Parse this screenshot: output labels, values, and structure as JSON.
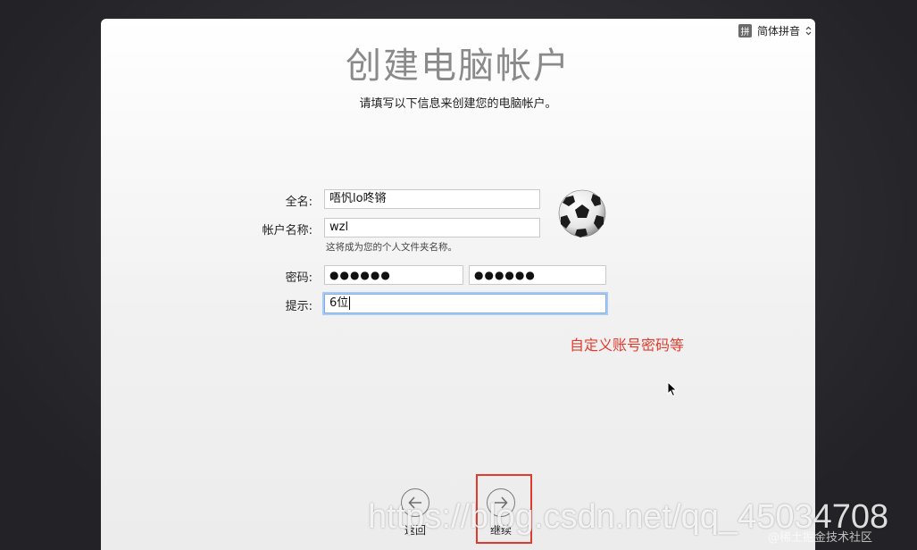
{
  "ime": {
    "badge": "拼",
    "label": "简体拼音"
  },
  "title": "创建电脑帐户",
  "subtitle": "请填写以下信息来创建您的电脑帐户。",
  "form": {
    "fullname_label": "全名:",
    "fullname_value": "唔忛lo咚锵",
    "account_label": "帐户名称:",
    "account_value": "wzl",
    "account_hint": "这将成为您的个人文件夹名称。",
    "password_label": "密码:",
    "password_value": "●●●●●●",
    "verify_value": "●●●●●●",
    "hint_label": "提示:",
    "hint_value": "6位"
  },
  "annotation": "自定义账号密码等",
  "nav": {
    "back_label": "返回",
    "continue_label": "继续"
  },
  "watermark": "https://blog.csdn.net/qq_45034708",
  "watermark_small": "@稀土掘金技术社区",
  "colors": {
    "annotation_red": "#e23b2e",
    "focus_blue": "#7eaee8",
    "title_gray": "#8a8a8a"
  }
}
